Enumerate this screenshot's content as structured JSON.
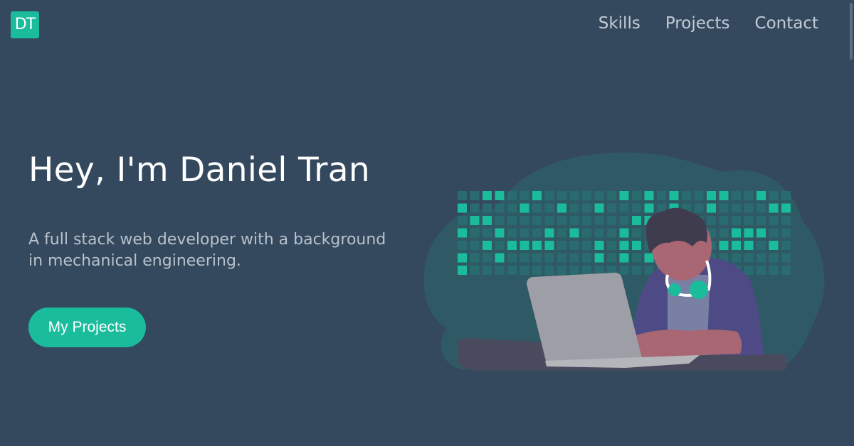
{
  "logo": {
    "text": "DT"
  },
  "nav": {
    "items": [
      "Skills",
      "Projects",
      "Contact"
    ]
  },
  "hero": {
    "title": "Hey, I'm Daniel Tran",
    "subtitle": "A full stack web developer with a background in mechanical engineering.",
    "cta_label": "My Projects"
  },
  "illustration": {
    "name": "developer-with-laptop"
  },
  "colors": {
    "background": "#34495e",
    "accent": "#1abc9c",
    "nav_text": "#c3ccd4",
    "heading": "#ffffff"
  }
}
